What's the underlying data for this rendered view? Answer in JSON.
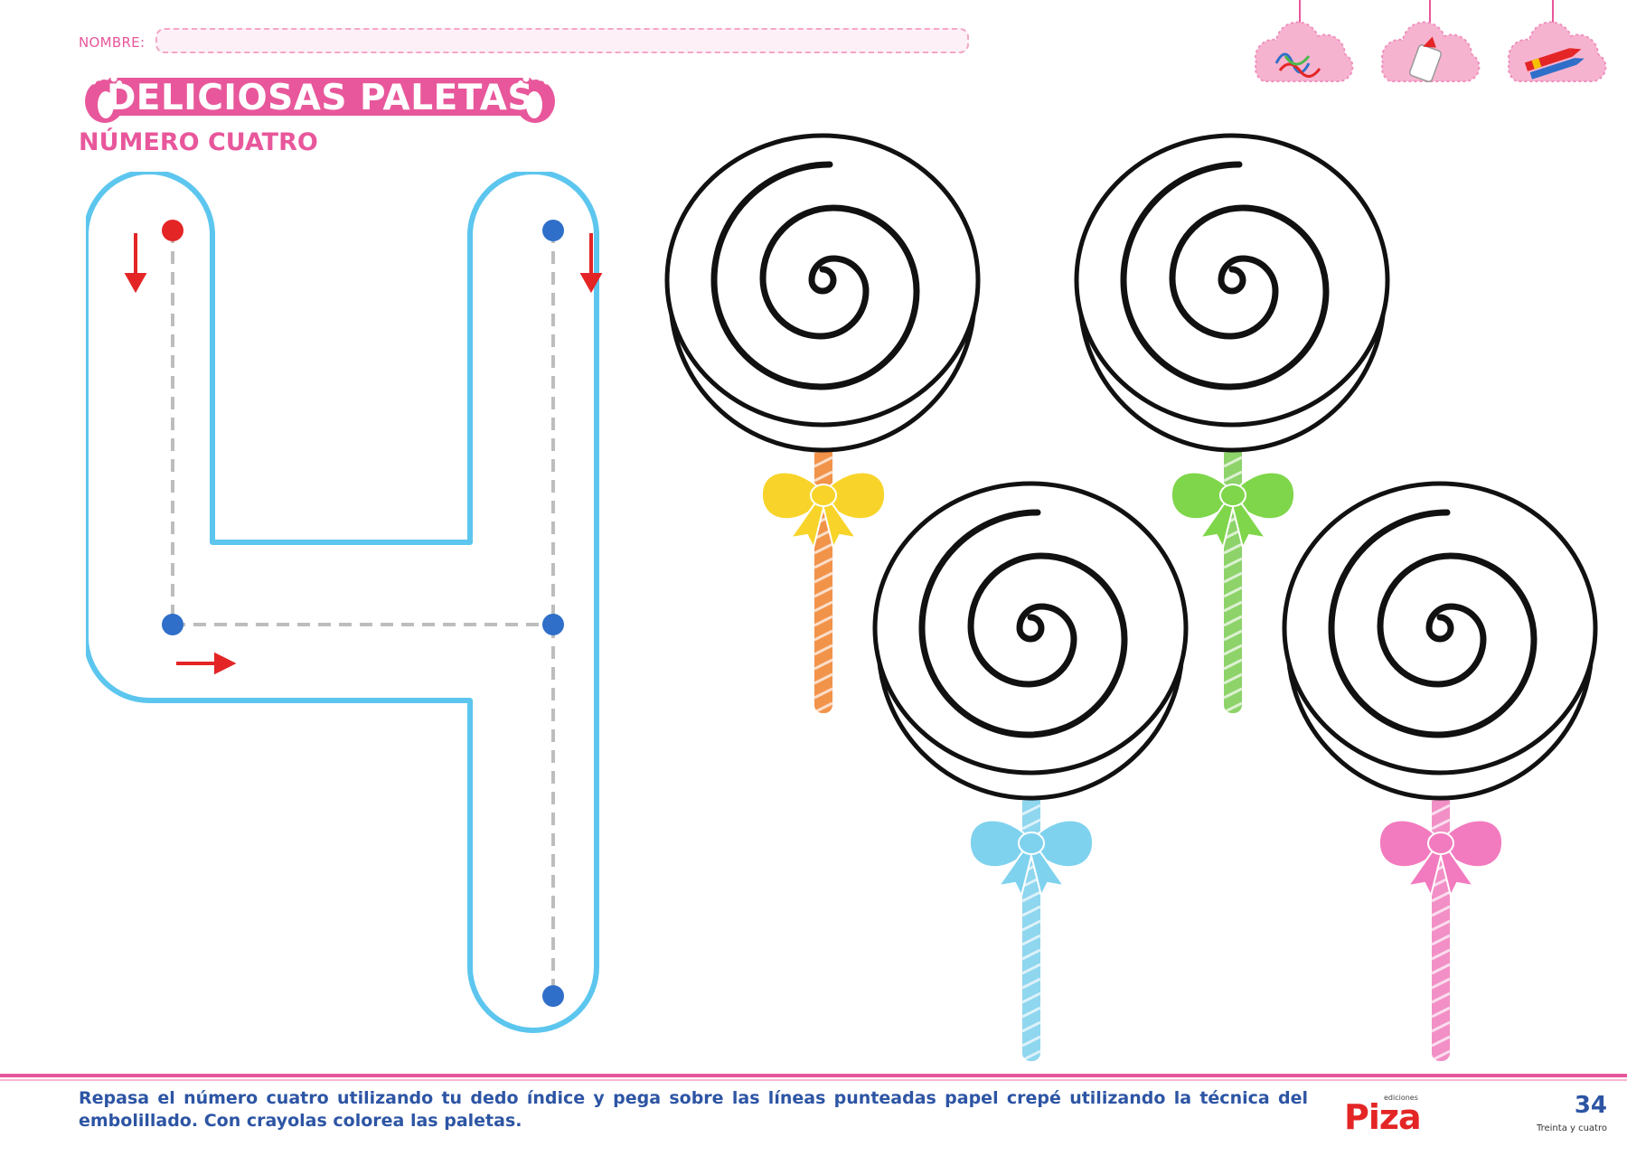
{
  "header": {
    "name_label": "NOMBRE:",
    "title": "DELICIOSAS PALETAS",
    "subtitle": "NÚMERO CUATRO"
  },
  "decorations": {
    "icons": [
      "ribbons-icon",
      "glue-bottle-icon",
      "crayon-icon"
    ],
    "cloud_color": "#f6b3d0"
  },
  "tracing": {
    "digit": 4,
    "outline_color": "#5cc6ee",
    "start_dot_color": "#e42526",
    "dot_color": "#2f6fc9",
    "arrow_color": "#e42526",
    "path_style": "dashed"
  },
  "lollipops": [
    {
      "bow_color": "#f8d42a",
      "stick_color": "#f2934a"
    },
    {
      "bow_color": "#7fd64a",
      "stick_color": "#8dd36a"
    },
    {
      "bow_color": "#7fd2ee",
      "stick_color": "#8fd6ef"
    },
    {
      "bow_color": "#f27bbf",
      "stick_color": "#f28fc6"
    }
  ],
  "footer": {
    "instructions": "Repasa el número cuatro utilizando tu dedo índice y pega sobre las líneas punteadas papel crepé utilizando la técnica del embolillado. Con crayolas colorea las paletas.",
    "brand": "Piza",
    "brand_small": "ediciones",
    "page_number": "34",
    "page_number_words": "Treinta y cuatro"
  }
}
